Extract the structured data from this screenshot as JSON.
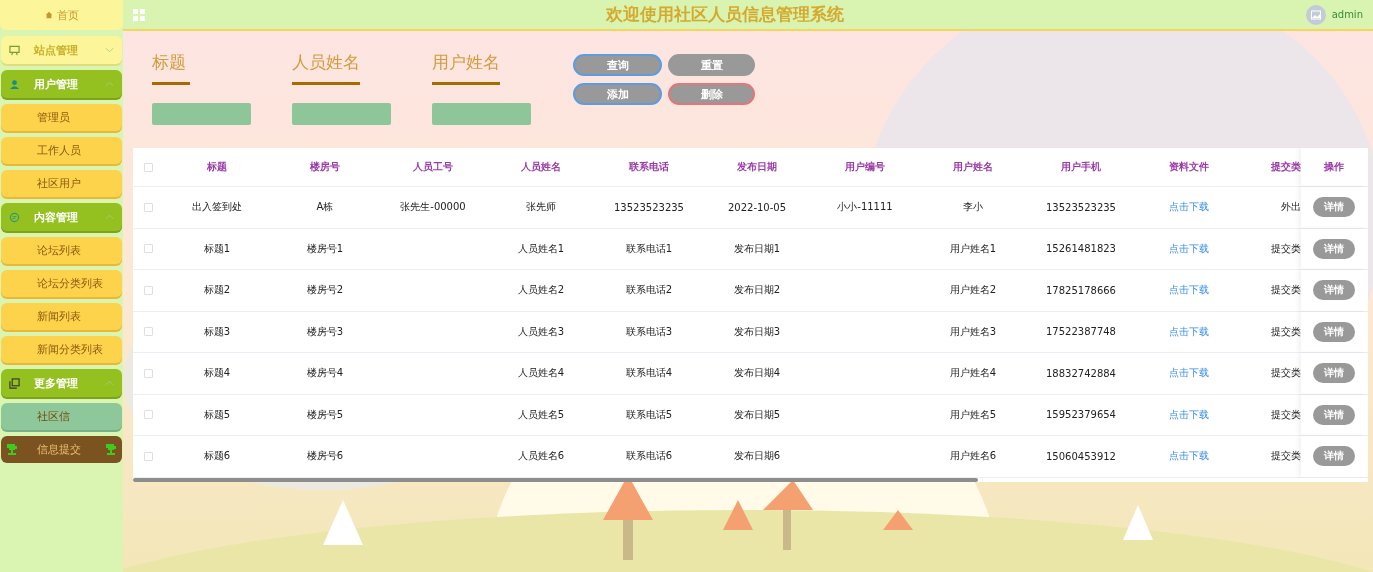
{
  "sidebar": {
    "home": "首页",
    "groups": [
      {
        "label": "站点管理",
        "expanded": false
      },
      {
        "label": "用户管理",
        "expanded": true,
        "children": [
          {
            "label": "管理员",
            "selected": false
          },
          {
            "label": "工作人员",
            "selected": false
          },
          {
            "label": "社区用户",
            "selected": false
          }
        ]
      },
      {
        "label": "内容管理",
        "expanded": true,
        "children": [
          {
            "label": "论坛列表",
            "selected": false
          },
          {
            "label": "论坛分类列表",
            "selected": false
          },
          {
            "label": "新闻列表",
            "selected": false
          },
          {
            "label": "新闻分类列表",
            "selected": false
          }
        ]
      },
      {
        "label": "更多管理",
        "expanded": true,
        "children": [
          {
            "label": "社区信",
            "selected": true
          }
        ]
      }
    ],
    "footer": "信息提交"
  },
  "header": {
    "title": "欢迎使用社区人员信息管理系统",
    "user": "admin"
  },
  "search": {
    "fields": [
      {
        "label": "标题"
      },
      {
        "label": "人员姓名"
      },
      {
        "label": "用户姓名"
      }
    ],
    "buttons": [
      {
        "label": "查询",
        "kind": "primary"
      },
      {
        "label": "重置",
        "kind": "plain"
      },
      {
        "label": "添加",
        "kind": "primary"
      },
      {
        "label": "删除",
        "kind": "danger"
      }
    ]
  },
  "table": {
    "columns": [
      {
        "label": "标题",
        "kind": "text"
      },
      {
        "label": "楼房号",
        "kind": "text"
      },
      {
        "label": "人员工号",
        "kind": "text"
      },
      {
        "label": "人员姓名",
        "kind": "text"
      },
      {
        "label": "联系电话",
        "kind": "text"
      },
      {
        "label": "发布日期",
        "kind": "text"
      },
      {
        "label": "用户编号",
        "kind": "text"
      },
      {
        "label": "用户姓名",
        "kind": "text"
      },
      {
        "label": "用户手机",
        "kind": "text"
      },
      {
        "label": "资料文件",
        "kind": "link"
      },
      {
        "label": "提交类",
        "kind": "cut"
      }
    ],
    "action_header": "操作",
    "all_checked": false,
    "rows": [
      {
        "cells": [
          "出入签到处",
          "A栋",
          "张先生-00000",
          "张先师",
          "13523523235",
          "2022-10-05",
          "小小-11111",
          "李小",
          "13523523235",
          "点击下载",
          "外出"
        ],
        "checked": false,
        "action": "详情"
      },
      {
        "cells": [
          "标题1",
          "楼房号1",
          "",
          "人员姓名1",
          "联系电话1",
          "发布日期1",
          "",
          "用户姓名1",
          "15261481823",
          "点击下载",
          "提交类"
        ],
        "checked": false,
        "action": "详情"
      },
      {
        "cells": [
          "标题2",
          "楼房号2",
          "",
          "人员姓名2",
          "联系电话2",
          "发布日期2",
          "",
          "用户姓名2",
          "17825178666",
          "点击下载",
          "提交类"
        ],
        "checked": false,
        "action": "详情"
      },
      {
        "cells": [
          "标题3",
          "楼房号3",
          "",
          "人员姓名3",
          "联系电话3",
          "发布日期3",
          "",
          "用户姓名3",
          "17522387748",
          "点击下载",
          "提交类"
        ],
        "checked": false,
        "action": "详情"
      },
      {
        "cells": [
          "标题4",
          "楼房号4",
          "",
          "人员姓名4",
          "联系电话4",
          "发布日期4",
          "",
          "用户姓名4",
          "18832742884",
          "点击下载",
          "提交类"
        ],
        "checked": false,
        "action": "详情"
      },
      {
        "cells": [
          "标题5",
          "楼房号5",
          "",
          "人员姓名5",
          "联系电话5",
          "发布日期5",
          "",
          "用户姓名5",
          "15952379654",
          "点击下载",
          "提交类"
        ],
        "checked": false,
        "action": "详情"
      },
      {
        "cells": [
          "标题6",
          "楼房号6",
          "",
          "人员姓名6",
          "联系电话6",
          "发布日期6",
          "",
          "用户姓名6",
          "15060453912",
          "点击下载",
          "提交类"
        ],
        "checked": false,
        "action": "详情"
      }
    ]
  }
}
